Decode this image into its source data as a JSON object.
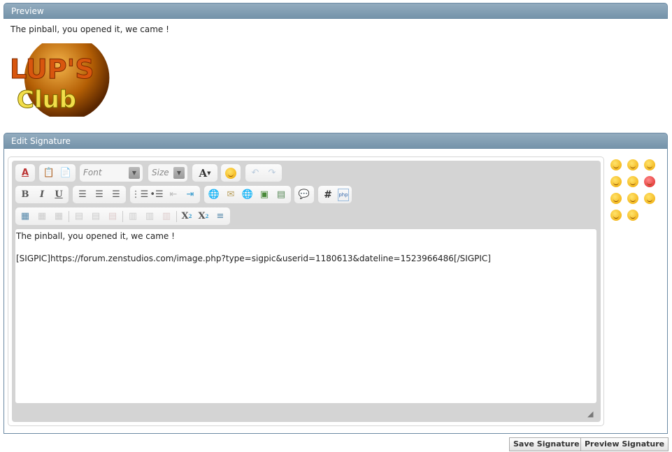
{
  "preview": {
    "title": "Preview",
    "text": "The pinball, you opened it, we came !",
    "image": {
      "line1": "LUP'S",
      "line2": "Club"
    }
  },
  "edit": {
    "title": "Edit Signature",
    "toolbar": {
      "font_placeholder": "Font",
      "size_placeholder": "Size",
      "row1": [
        "remove-format-icon",
        "paste-icon",
        "paste-word-icon",
        "font-select",
        "size-select",
        "text-color-icon",
        "smiley-icon",
        "undo-icon",
        "redo-icon"
      ],
      "row2": [
        "bold-icon",
        "italic-icon",
        "underline-icon",
        "align-left-icon",
        "align-center-icon",
        "align-right-icon",
        "ordered-list-icon",
        "unordered-list-icon",
        "outdent-icon",
        "indent-icon",
        "link-icon",
        "email-icon",
        "unlink-icon",
        "image-icon",
        "video-icon",
        "quote-icon",
        "hash-icon",
        "php-icon"
      ],
      "row3": [
        "table-icon",
        "table-props-icon",
        "delete-table-icon",
        "insert-row-above-icon",
        "insert-row-below-icon",
        "delete-row-icon",
        "insert-col-left-icon",
        "insert-col-right-icon",
        "delete-col-icon",
        "subscript-icon",
        "superscript-icon",
        "horizontal-rule-icon"
      ]
    },
    "content": "The pinball, you opened it, we came !\n\n[SIGPIC]https://forum.zenstudios.com/image.php?type=sigpic&userid=1180613&dateline=1523966486[/SIGPIC]",
    "smilies": [
      "grin",
      "blush",
      "smile",
      "frown",
      "confused",
      "mad",
      "tongue",
      "biggrin",
      "rolleyes",
      "cool",
      "eek"
    ]
  },
  "buttons": {
    "save": "Save Signature",
    "preview": "Preview Signature"
  }
}
